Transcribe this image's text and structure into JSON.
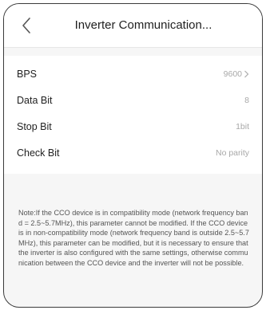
{
  "header": {
    "title": "Inverter Communication...",
    "back_icon": "chevron-left-icon"
  },
  "settings": {
    "rows": [
      {
        "label": "BPS",
        "value": "9600",
        "has_chevron": true
      },
      {
        "label": "Data Bit",
        "value": "8",
        "has_chevron": false
      },
      {
        "label": "Stop Bit",
        "value": "1bit",
        "has_chevron": false
      },
      {
        "label": "Check Bit",
        "value": "No parity",
        "has_chevron": false
      }
    ]
  },
  "note": {
    "text": "Note:If the CCO device is in compatibility mode (network frequency band = 2.5~5.7MHz), this parameter cannot be modified. If the CCO device is in non-compatibility mode (network frequency band is outside 2.5~5.7MHz), this parameter can be modified, but it is necessary to ensure that the inverter is also configured with the same settings, otherwise communication between the CCO device and the inverter will not be possible."
  },
  "colors": {
    "background": "#f6f6f6",
    "card": "#ffffff",
    "label_text": "#222222",
    "value_text": "#a8a8a8",
    "note_text": "#555555"
  }
}
